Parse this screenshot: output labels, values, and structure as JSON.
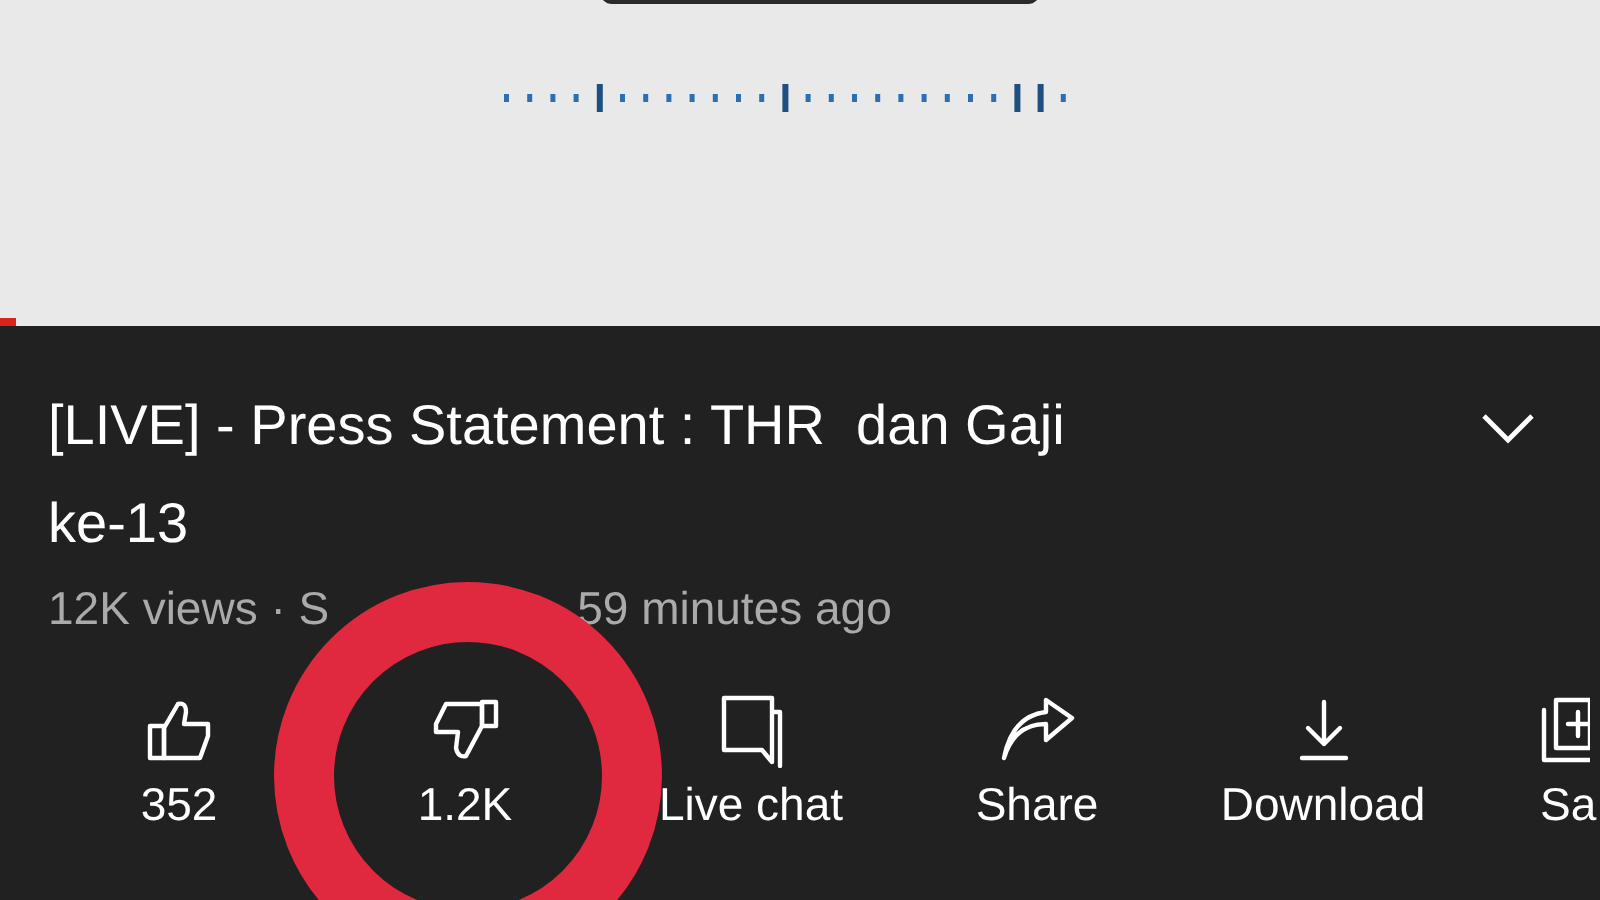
{
  "title": "[LIVE] - Press Statement : THR  dan Gaji ke-13",
  "meta": {
    "views_part": "12K views · S",
    "time_part": "59 minutes ago"
  },
  "actions": [
    {
      "kind": "like",
      "label": "352"
    },
    {
      "kind": "dislike",
      "label": "1.2K"
    },
    {
      "kind": "chat",
      "label": "Live chat"
    },
    {
      "kind": "share",
      "label": "Share"
    },
    {
      "kind": "download",
      "label": "Download"
    },
    {
      "kind": "save",
      "label": "Sa"
    }
  ],
  "annotation": {
    "kind": "ring",
    "color": "#e0283f"
  }
}
